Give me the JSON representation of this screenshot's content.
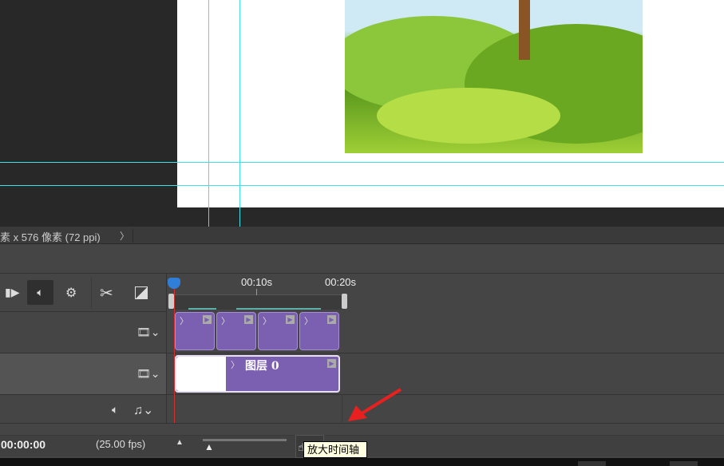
{
  "status_bar": {
    "doc_info": "素 x 576 像素 (72 ppi)",
    "more": "〉"
  },
  "ruler": {
    "ticks": [
      "00:10s",
      "00:20s"
    ]
  },
  "tracks": [
    {
      "clips": [
        {
          "label": ""
        },
        {
          "label": ""
        },
        {
          "label": ""
        },
        {
          "label": ""
        }
      ]
    },
    {
      "clips": [
        {
          "label": "图层 0"
        }
      ]
    }
  ],
  "footer": {
    "timecode": "00:00:00",
    "fps": "(25.00 fps)"
  },
  "tooltip": "放大时间轴",
  "colors": {
    "clip": "#7b5fb0",
    "playhead": "#d03030",
    "guide": "#40e0e8",
    "annotation_arrow": "#e82020"
  }
}
